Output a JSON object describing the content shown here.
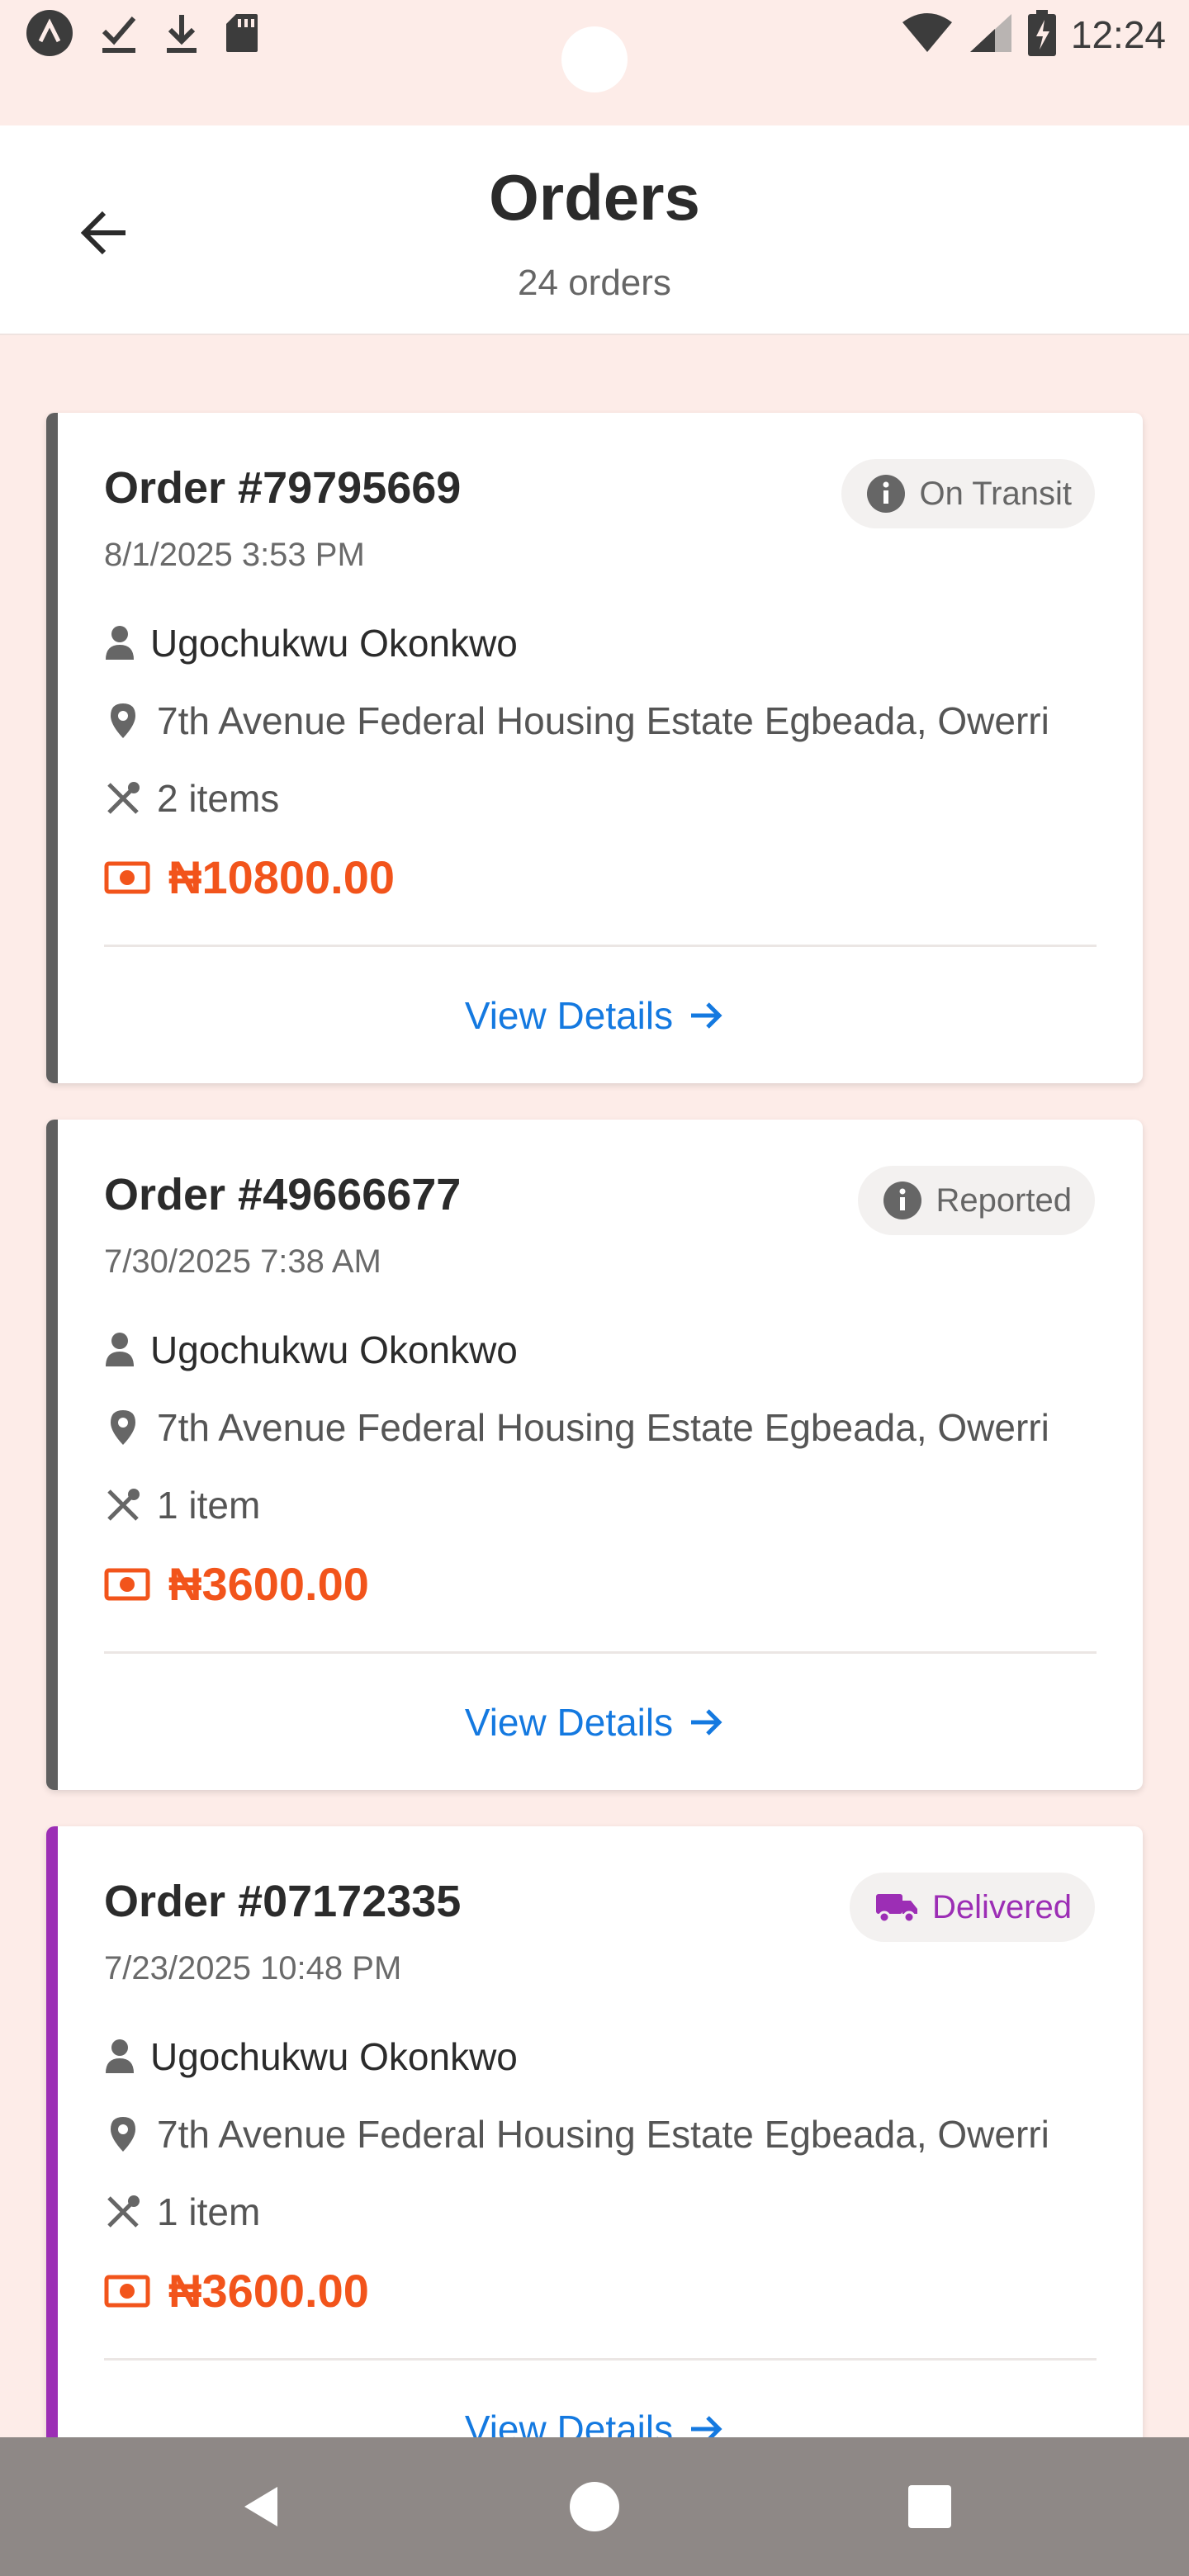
{
  "status_bar": {
    "time": "12:24",
    "left_icons": [
      "app-a-icon",
      "check-download-icon",
      "download-icon",
      "sd-card-icon"
    ],
    "right_icons": [
      "wifi-icon",
      "signal-icon",
      "battery-charging-icon"
    ]
  },
  "header": {
    "title": "Orders",
    "subtitle": "24 orders",
    "back_icon": "arrow-left-icon"
  },
  "colors": {
    "accent_grey": "#5f5f5f",
    "accent_purple": "#9c2eb5",
    "amount_orange": "#f2541b",
    "link_blue": "#1479e0",
    "background": "#fdece8"
  },
  "orders": [
    {
      "title": "Order #79795669",
      "date": "8/1/2025 3:53 PM",
      "status": "On Transit",
      "status_icon": "info-icon",
      "customer": "Ugochukwu Okonkwo",
      "address": "7th Avenue Federal Housing Estate Egbeada, Owerri",
      "items": "2 items",
      "amount": "₦10800.00",
      "view_label": "View Details"
    },
    {
      "title": "Order #49666677",
      "date": "7/30/2025 7:38 AM",
      "status": "Reported",
      "status_icon": "info-icon",
      "customer": "Ugochukwu Okonkwo",
      "address": "7th Avenue Federal Housing Estate Egbeada, Owerri",
      "items": "1 item",
      "amount": "₦3600.00",
      "view_label": "View Details"
    },
    {
      "title": "Order #07172335",
      "date": "7/23/2025 10:48 PM",
      "status": "Delivered",
      "status_icon": "truck-icon",
      "customer": "Ugochukwu Okonkwo",
      "address": "7th Avenue Federal Housing Estate Egbeada, Owerri",
      "items": "1 item",
      "amount": "₦3600.00",
      "view_label": "View Details"
    }
  ],
  "nav_bar": {
    "buttons": [
      "back-triangle-icon",
      "home-circle-icon",
      "recents-square-icon"
    ]
  }
}
